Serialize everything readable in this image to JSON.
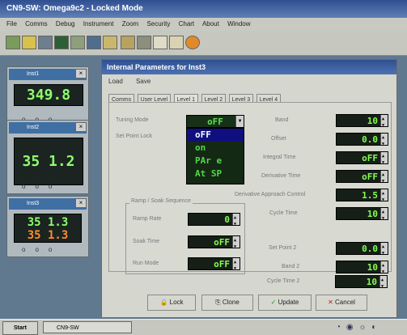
{
  "app": {
    "title": "CN9-SW: Omega9c2 - Locked Mode"
  },
  "menu": [
    "File",
    "Comms",
    "Debug",
    "Instrument",
    "Zoom",
    "Security",
    "Chart",
    "About",
    "Window"
  ],
  "instruments": [
    {
      "title": "Inst1",
      "display_top": "349.8"
    },
    {
      "title": "Inst2",
      "display_top": "35 1.2"
    },
    {
      "title": "Inst3",
      "display_top": "35 1.3",
      "display_bottom": "35 1.3"
    }
  ],
  "dialog": {
    "title": "Internal Parameters for Inst3",
    "menu": [
      "Load",
      "Save"
    ],
    "tabs": [
      "Comms",
      "User Level",
      "Level 1",
      "Level 2",
      "Level 3",
      "Level 4"
    ],
    "tuning_mode": {
      "label": "Tuning Mode",
      "value": "oFF",
      "options": [
        "oFF",
        "on",
        "PAr e",
        "At SP"
      ]
    },
    "set_point_lock_label": "Set Point Lock",
    "ramp_group_title": "Ramp / Soak Sequence",
    "ramp_rate": {
      "label": "Ramp Rate",
      "value": "0"
    },
    "soak_time": {
      "label": "Soak Time",
      "value": "oFF"
    },
    "run_mode": {
      "label": "Run Mode",
      "value": "oFF"
    },
    "band": {
      "label": "Band",
      "value": "10"
    },
    "offset": {
      "label": "Offset",
      "value": "0.0"
    },
    "integral_time": {
      "label": "Integral Time",
      "value": "oFF"
    },
    "derivative_time": {
      "label": "Derivative Time",
      "value": "oFF"
    },
    "derivative_approach_control": {
      "label": "Derivative Approach Control",
      "value": "1.5"
    },
    "cycle_time": {
      "label": "Cycle Time",
      "value": "10"
    },
    "set_point_2": {
      "label": "Set Point 2",
      "value": "0.0"
    },
    "band_2": {
      "label": "Band 2",
      "value": "10"
    },
    "cycle_time_2": {
      "label": "Cycle Time 2",
      "value": "10"
    },
    "buttons": {
      "lock": "Lock",
      "clone": "Clone",
      "update": "Update",
      "cancel": "Cancel"
    }
  },
  "taskbar": {
    "start": "Start",
    "app": "CN9-SW"
  }
}
